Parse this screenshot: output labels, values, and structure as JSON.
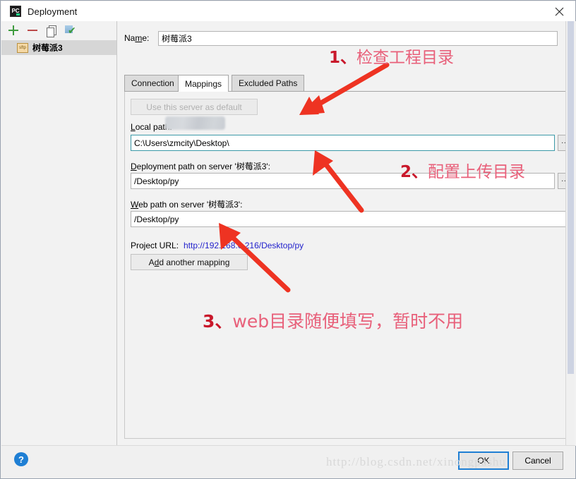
{
  "window": {
    "title": "Deployment",
    "app_icon": "pycharm-icon",
    "close_icon": "close-icon"
  },
  "sidebar": {
    "toolbar": [
      {
        "name": "add-server-button",
        "icon": "plus-icon",
        "label": "+"
      },
      {
        "name": "remove-server-button",
        "icon": "minus-icon",
        "label": "−"
      },
      {
        "name": "copy-server-button",
        "icon": "copy-icon",
        "label": ""
      },
      {
        "name": "set-default-button",
        "icon": "green-check-icon",
        "label": ""
      }
    ],
    "servers": [
      {
        "badge": "sftp",
        "name": "树莓派3",
        "selected": true
      }
    ]
  },
  "form": {
    "name_label": "Na",
    "name_label_mnemonic": "m",
    "name_label_rest": "e:",
    "name_value": "树莓派3"
  },
  "tabs": [
    {
      "label": "Connection",
      "active": false
    },
    {
      "label": "Mappings",
      "active": true
    },
    {
      "label": "Excluded Paths",
      "active": false
    }
  ],
  "mappings": {
    "use_default_button": "Use this server as default",
    "local_path_label_head": "L",
    "local_path_label_rest": "ocal path:",
    "local_path_value": "C:\\Users\\zmcity\\Desktop\\",
    "local_path_browse": "...",
    "deployment_path_label_head": "D",
    "deployment_path_label_rest": "eployment path on server '树莓派3':",
    "deployment_path_value": "/Desktop/py",
    "deployment_path_browse": "...",
    "web_path_label_head": "W",
    "web_path_label_rest": "eb path on server '树莓派3':",
    "web_path_value": "/Desktop/py",
    "project_url_label": "Project URL:",
    "project_url_value": "http://192.168.0.216/Desktop/py",
    "add_mapping_head": "A",
    "add_mapping_mnemonic": "d",
    "add_mapping_rest": "d another mapping"
  },
  "footer": {
    "help_label": "?",
    "ok_label": "OK",
    "cancel_label": "Cancel"
  },
  "watermark": "http://blog.csdn.net/xinongpashu",
  "annotations": [
    {
      "id": "anno1",
      "number": "1、",
      "text": "检查工程目录"
    },
    {
      "id": "anno2",
      "number": "2、",
      "text": "配置上传目录"
    },
    {
      "id": "anno3",
      "number": "3、",
      "text": "web目录随便填写，暂时不用"
    }
  ],
  "colors": {
    "annotation_red": "#e8607a",
    "annotation_number_red": "#c9182b",
    "arrow_red": "#ee3322",
    "link_blue": "#2222cc",
    "focus_border": "#3c9aa8",
    "ok_border": "#1f7fd4"
  }
}
